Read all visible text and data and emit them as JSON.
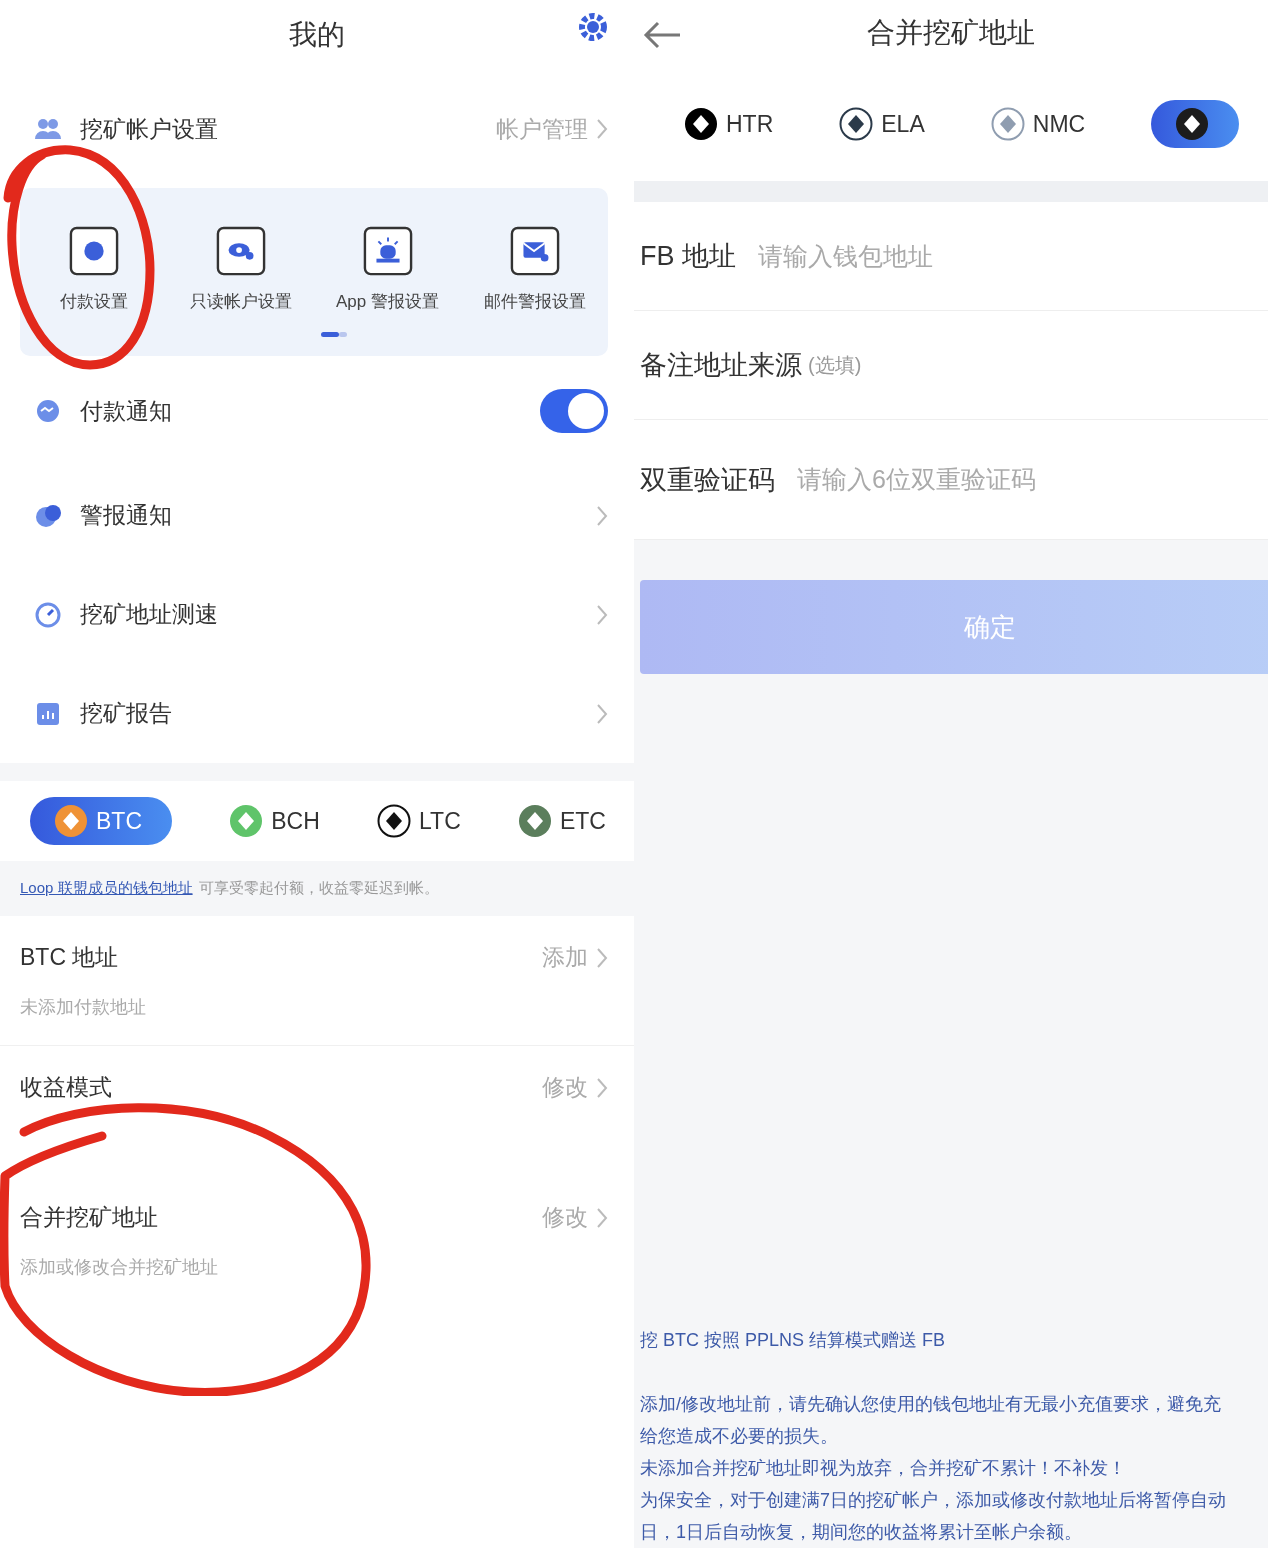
{
  "left": {
    "title": "我的",
    "account": {
      "label": "挖矿帐户设置",
      "action": "帐户管理"
    },
    "shortcuts": [
      {
        "label": "付款设置"
      },
      {
        "label": "只读帐户设置"
      },
      {
        "label": "App 警报设置"
      },
      {
        "label": "邮件警报设置"
      }
    ],
    "menu": [
      {
        "kind": "toggle",
        "label": "付款通知",
        "on": true
      },
      {
        "kind": "link",
        "label": "警报通知"
      },
      {
        "kind": "link",
        "label": "挖矿地址测速"
      },
      {
        "kind": "link",
        "label": "挖矿报告"
      }
    ],
    "coins": [
      {
        "label": "BTC",
        "selected": true,
        "color": "#ef9236"
      },
      {
        "label": "BCH",
        "selected": false,
        "color": "#5fc46a"
      },
      {
        "label": "LTC",
        "selected": false,
        "color": "#111111"
      },
      {
        "label": "ETC",
        "selected": false,
        "color": "#5b7e5c"
      }
    ],
    "notice": {
      "link": "Loop 联盟成员的钱包地址",
      "text": "可享受零起付额，收益零延迟到帐。"
    },
    "settings": [
      {
        "title": "BTC 地址",
        "action": "添加",
        "subtitle": "未添加付款地址"
      },
      {
        "title": "收益模式",
        "action": "修改"
      },
      {
        "title": "合并挖矿地址",
        "action": "修改",
        "subtitle": "添加或修改合并挖矿地址"
      }
    ]
  },
  "right": {
    "title": "合并挖矿地址",
    "coins": [
      {
        "label": "HTR",
        "selected": false,
        "color": "#000000"
      },
      {
        "label": "ELA",
        "selected": false,
        "color": "#2b3a4a"
      },
      {
        "label": "NMC",
        "selected": false,
        "color": "#8f9db0"
      },
      {
        "selected": true,
        "color": "#1c1c1c"
      }
    ],
    "fields": [
      {
        "label": "FB 地址",
        "placeholder": "请输入钱包地址"
      },
      {
        "label": "备注地址来源",
        "hint": "(选填)"
      },
      {
        "label": "双重验证码",
        "placeholder": "请输入6位双重验证码"
      }
    ],
    "confirm": "确定",
    "notes": [
      {
        "lines": [
          "挖 BTC 按照 PPLNS 结算模式赠送 FB"
        ]
      },
      {
        "lines": [
          "添加/修改地址前，请先确认您使用的钱包地址有无最小充值要求，避免充",
          "给您造成不必要的损失。",
          "未添加合并挖矿地址即视为放弃，合并挖矿不累计！不补发！",
          "为保安全，对于创建满7日的挖矿帐户，添加或修改付款地址后将暂停自动",
          "日，1日后自动恢复，期间您的收益将累计至帐户余额。"
        ]
      }
    ]
  }
}
